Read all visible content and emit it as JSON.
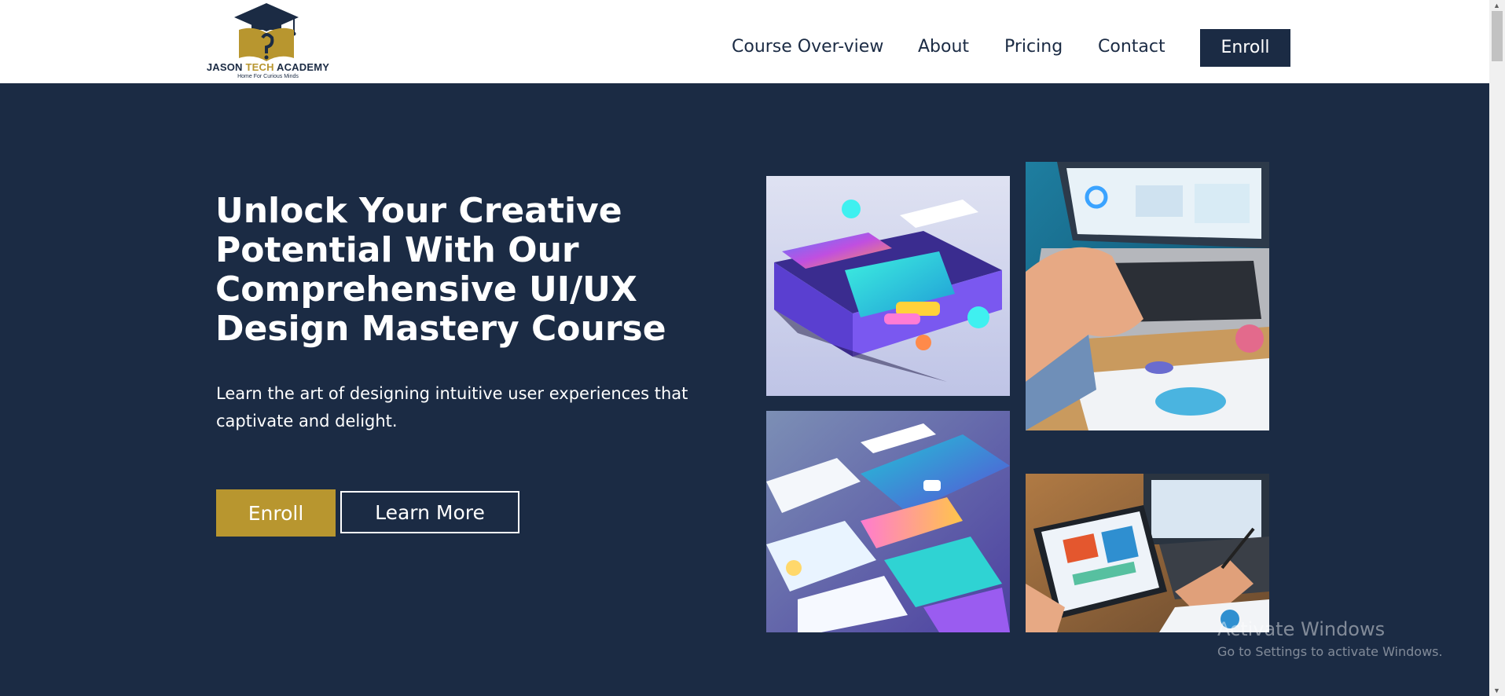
{
  "logo": {
    "name_part1": "JASON ",
    "name_part2": "TECH ",
    "name_part3": "ACADEMY",
    "tagline": "Home For Curious Minds"
  },
  "nav": {
    "items": [
      {
        "label": "Course Over-view"
      },
      {
        "label": "About"
      },
      {
        "label": "Pricing"
      },
      {
        "label": "Contact"
      }
    ],
    "enroll_label": "Enroll"
  },
  "hero": {
    "title": "Unlock Your Creative Potential With Our Comprehensive UI/UX Design Mastery Course",
    "subtitle": "Learn the art of designing intuitive user experiences that captivate and delight.",
    "enroll_label": "Enroll",
    "learn_more_label": "Learn More"
  },
  "watermark": {
    "title": "Activate Windows",
    "subtitle": "Go to Settings to activate Windows."
  },
  "colors": {
    "navy": "#1b2b44",
    "gold": "#b8962f",
    "white": "#ffffff"
  }
}
